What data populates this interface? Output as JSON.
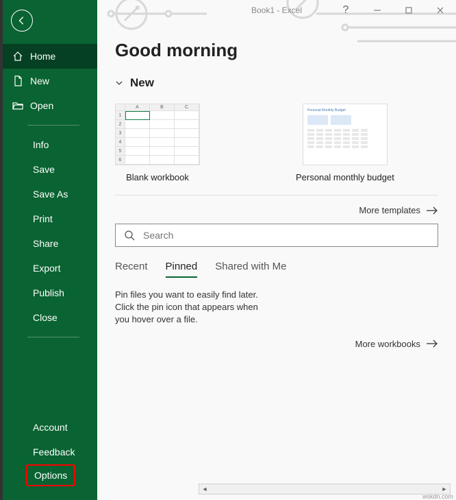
{
  "window": {
    "title": "Book1 - Excel",
    "help": "?"
  },
  "sidebar": {
    "home": "Home",
    "new": "New",
    "open": "Open",
    "info": "Info",
    "save": "Save",
    "saveAs": "Save As",
    "print": "Print",
    "share": "Share",
    "export": "Export",
    "publish": "Publish",
    "close": "Close",
    "account": "Account",
    "feedback": "Feedback",
    "options": "Options"
  },
  "main": {
    "greeting": "Good morning",
    "newSection": "New",
    "templates": {
      "blank": "Blank workbook",
      "budget": "Personal monthly budget",
      "budgetTitle": "Personal Monthly Budget"
    },
    "moreTemplates": "More templates",
    "search": {
      "placeholder": "Search"
    },
    "tabs": {
      "recent": "Recent",
      "pinned": "Pinned",
      "shared": "Shared with Me"
    },
    "hint": "Pin files you want to easily find later. Click the pin icon that appears when you hover over a file.",
    "moreWorkbooks": "More workbooks"
  },
  "watermark": "wskdn.com"
}
